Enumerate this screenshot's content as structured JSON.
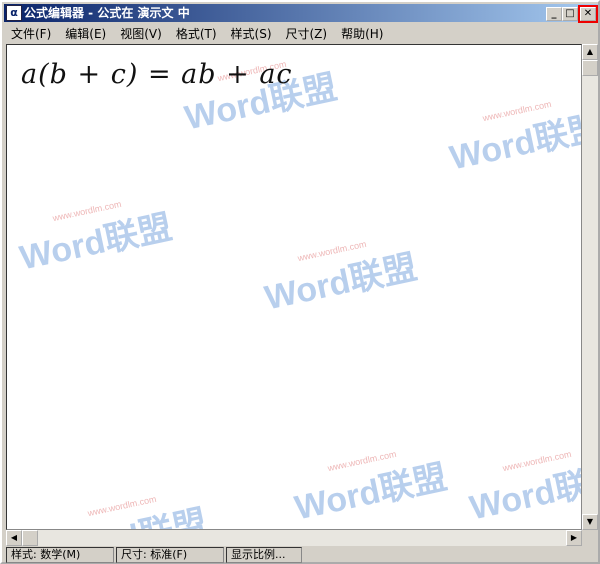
{
  "window": {
    "title": "公式编辑器 - 公式在 演示文 中",
    "icon": "equation-editor-icon"
  },
  "menu": [
    "文件(F)",
    "编辑(E)",
    "视图(V)",
    "格式(T)",
    "样式(S)",
    "尺寸(Z)",
    "帮助(H)"
  ],
  "equation": "a(b + c) = ab + ac",
  "watermark": {
    "brand": "Word联盟",
    "url": "www.wordlm.com"
  },
  "status": {
    "style": "样式: 数学(M)",
    "size": "尺寸: 标准(F)",
    "zoom": "显示比例..."
  }
}
